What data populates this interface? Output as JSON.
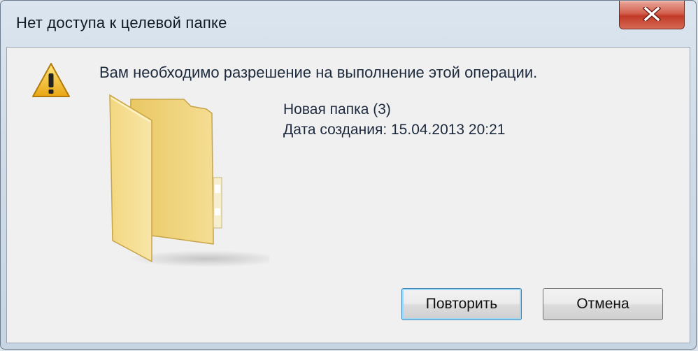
{
  "window": {
    "title": "Нет доступа к целевой папке"
  },
  "dialog": {
    "message": "Вам необходимо разрешение на выполнение этой операции.",
    "item": {
      "name": "Новая папка (3)",
      "date_label": "Дата создания:",
      "date_value": "15.04.2013 20:21"
    },
    "icons": {
      "warning": "warning-icon",
      "folder": "folder-icon",
      "close": "close-icon"
    }
  },
  "buttons": {
    "retry": "Повторить",
    "cancel": "Отмена"
  },
  "colors": {
    "close_button": "#c13a27",
    "folder": "#f1d88a",
    "warning": "#f4c12b",
    "primary_button_border": "#3c7fb1"
  }
}
